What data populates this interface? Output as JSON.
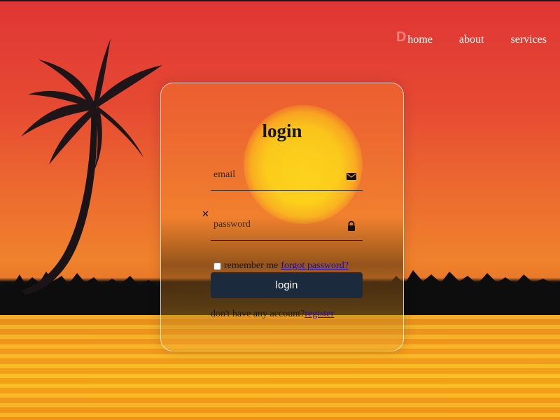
{
  "nav": {
    "items": [
      {
        "label": "home"
      },
      {
        "label": "about"
      },
      {
        "label": "services"
      }
    ]
  },
  "form": {
    "title": "login",
    "email_placeholder": "email",
    "password_placeholder": "password",
    "remember_label": "remember me",
    "forgot_link": "forgot password?",
    "login_button": "login",
    "no_account_text": "don't have any account?",
    "register_link": "register"
  },
  "icons": {
    "email": "envelope-icon",
    "password": "lock-icon",
    "close": "close-icon"
  },
  "colors": {
    "button_bg": "#1c2a3d",
    "link": "#1a0dab",
    "sun": "#ffff10"
  }
}
